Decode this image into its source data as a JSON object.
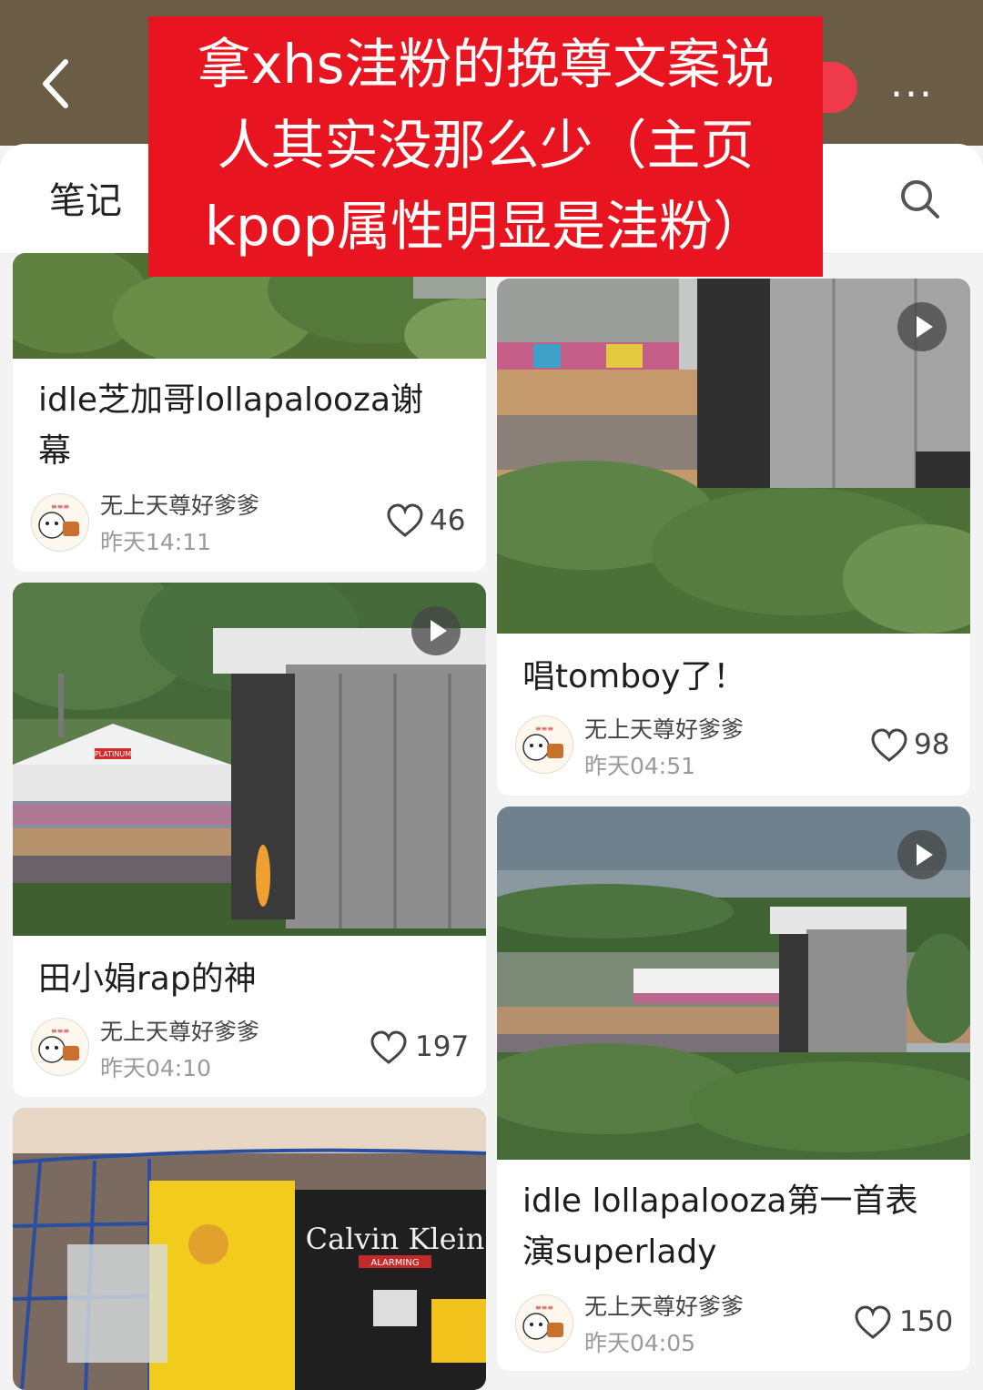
{
  "header": {
    "tab_notes": "笔记",
    "more": "..."
  },
  "banner": {
    "lines": [
      "拿xhs洼粉的挽尊文案说",
      "人其实没那么少（主页",
      "kpop属性明显是洼粉）"
    ]
  },
  "posts": [
    {
      "title_1": "idle芝加哥lollapalooza谢",
      "title_2": "幕",
      "author": "无上天尊好爹爹",
      "time": "昨天14:11",
      "likes": "46"
    },
    {
      "title_1": "唱tomboy了！",
      "author": "无上天尊好爹爹",
      "time": "昨天04:51",
      "likes": "98"
    },
    {
      "title_1": "田小娟rap的神",
      "author": "无上天尊好爹爹",
      "time": "昨天04:10",
      "likes": "197"
    },
    {
      "title_1": "idle lollapalooza第一首表",
      "title_2": "演superlady",
      "author": "无上天尊好爹爹",
      "time": "昨天04:05",
      "likes": "150"
    }
  ],
  "photo_text": {
    "tent_sign": "PLATINUM",
    "brand": "Calvin Klein",
    "brand_tag": "ALARMING"
  },
  "colors": {
    "header_bg": "#6b5c45",
    "banner_red": "#e8141f",
    "accent": "#ef3a4a"
  },
  "icons": [
    "back-arrow-icon",
    "more-dots-icon",
    "search-icon",
    "heart-icon",
    "play-icon"
  ]
}
